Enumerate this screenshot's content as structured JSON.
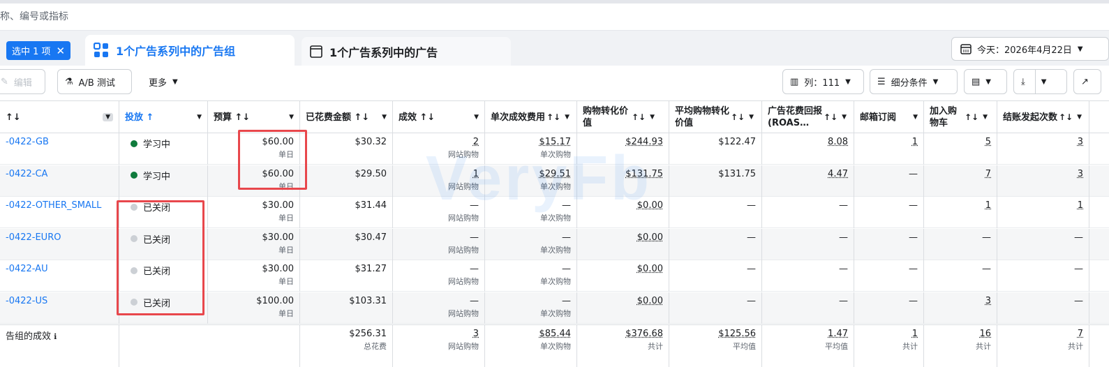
{
  "search": {
    "placeholder": "称、编号或指标"
  },
  "selection": {
    "label": "选中 1 项"
  },
  "tabs": [
    {
      "label": "1个广告系列中的广告组"
    },
    {
      "label": "1个广告系列中的广告"
    }
  ],
  "date": {
    "label": "今天：2026年4月22日"
  },
  "toolbar": {
    "edit": "编辑",
    "ab_test": "A/B 测试",
    "more": "更多",
    "columns": "列：111",
    "breakdown": "细分条件"
  },
  "columns": [
    {
      "label": "↑↓"
    },
    {
      "label": "投放"
    },
    {
      "label": "预算"
    },
    {
      "label": "已花费金额"
    },
    {
      "label": "成效"
    },
    {
      "label": "单次成效费用"
    },
    {
      "label": "购物转化价值"
    },
    {
      "label": "平均购物转化价值"
    },
    {
      "label": "广告花费回报 (ROAS…"
    },
    {
      "label": "邮箱订阅"
    },
    {
      "label": "加入购物车"
    },
    {
      "label": "结账发起次数"
    }
  ],
  "rows": [
    {
      "name": "-0422-GB",
      "status": "学习中",
      "status_color": "#0f7b3c",
      "budget": "$60.00",
      "budget_sub": "单日",
      "spent": "$30.32",
      "results": "2",
      "results_sub": "网站购物",
      "cpr": "$15.17",
      "cpr_sub": "单次购物",
      "conv_value": "$244.93",
      "avg_value": "$122.47",
      "roas": "8.08",
      "email": "1",
      "cart": "5",
      "checkout": "3"
    },
    {
      "name": "-0422-CA",
      "status": "学习中",
      "status_color": "#0f7b3c",
      "budget": "$60.00",
      "budget_sub": "单日",
      "spent": "$29.50",
      "results": "1",
      "results_sub": "网站购物",
      "cpr": "$29.51",
      "cpr_sub": "单次购物",
      "conv_value": "$131.75",
      "avg_value": "$131.75",
      "roas": "4.47",
      "email": "—",
      "cart": "7",
      "checkout": "3"
    },
    {
      "name": "-0422-OTHER_SMALL",
      "status": "已关闭",
      "status_color": "#ccd0d5",
      "budget": "$30.00",
      "budget_sub": "单日",
      "spent": "$31.44",
      "results": "—",
      "results_sub": "网站购物",
      "cpr": "—",
      "cpr_sub": "单次购物",
      "conv_value": "$0.00",
      "avg_value": "—",
      "roas": "—",
      "email": "—",
      "cart": "1",
      "checkout": "1"
    },
    {
      "name": "-0422-EURO",
      "status": "已关闭",
      "status_color": "#ccd0d5",
      "budget": "$30.00",
      "budget_sub": "单日",
      "spent": "$30.47",
      "results": "—",
      "results_sub": "网站购物",
      "cpr": "—",
      "cpr_sub": "单次购物",
      "conv_value": "$0.00",
      "avg_value": "—",
      "roas": "—",
      "email": "—",
      "cart": "—",
      "checkout": "—"
    },
    {
      "name": "-0422-AU",
      "status": "已关闭",
      "status_color": "#ccd0d5",
      "budget": "$30.00",
      "budget_sub": "单日",
      "spent": "$31.27",
      "results": "—",
      "results_sub": "网站购物",
      "cpr": "—",
      "cpr_sub": "单次购物",
      "conv_value": "$0.00",
      "avg_value": "—",
      "roas": "—",
      "email": "—",
      "cart": "—",
      "checkout": "—"
    },
    {
      "name": "-0422-US",
      "status": "已关闭",
      "status_color": "#ccd0d5",
      "budget": "$100.00",
      "budget_sub": "单日",
      "spent": "$103.31",
      "results": "—",
      "results_sub": "网站购物",
      "cpr": "—",
      "cpr_sub": "单次购物",
      "conv_value": "$0.00",
      "avg_value": "—",
      "roas": "—",
      "email": "—",
      "cart": "3",
      "checkout": "—"
    }
  ],
  "summary": {
    "label": "告组的成效",
    "spent": "$256.31",
    "spent_sub": "总花费",
    "results": "3",
    "results_sub": "网站购物",
    "cpr": "$85.44",
    "cpr_sub": "单次购物",
    "conv_value": "$376.68",
    "conv_value_sub": "共计",
    "avg_value": "$125.56",
    "avg_value_sub": "平均值",
    "roas": "1.47",
    "roas_sub": "平均值",
    "email": "1",
    "email_sub": "共计",
    "cart": "16",
    "cart_sub": "共计",
    "checkout": "7",
    "checkout_sub": "共计"
  },
  "watermark": "VeryFb",
  "colors": {
    "accent": "#1877f2",
    "highlight": "#e8474c"
  }
}
